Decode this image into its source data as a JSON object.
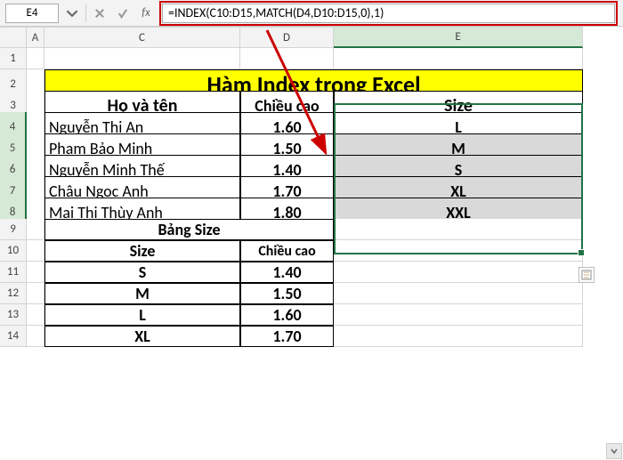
{
  "namebox": "E4",
  "formula": "=INDEX(C10:D15,MATCH(D4,D10:D15,0),1)",
  "columns": [
    "A",
    "C",
    "D",
    "E"
  ],
  "rows": [
    "1",
    "2",
    "3",
    "4",
    "5",
    "6",
    "7",
    "8",
    "9",
    "10",
    "11",
    "12",
    "13",
    "14"
  ],
  "title": "Hàm Index trong Excel",
  "headers": {
    "name": "Họ và tên",
    "height": "Chiều cao",
    "size": "Size",
    "sizetable": "Bảng Size",
    "sizecol": "Size",
    "heightcol": "Chiều cao"
  },
  "people": [
    {
      "name": "Nguyễn Thị An",
      "height": "1.60",
      "size": "L"
    },
    {
      "name": "Phạm Bảo Minh",
      "height": "1.50",
      "size": "M"
    },
    {
      "name": "Nguyễn Minh Thế",
      "height": "1.40",
      "size": "S"
    },
    {
      "name": "Châu Ngọc Anh",
      "height": "1.70",
      "size": "XL"
    },
    {
      "name": "Mai Thị Thùy Anh",
      "height": "1.80",
      "size": "XXL"
    }
  ],
  "sizetable": [
    {
      "size": "S",
      "height": "1.40"
    },
    {
      "size": "M",
      "height": "1.50"
    },
    {
      "size": "L",
      "height": "1.60"
    },
    {
      "size": "XL",
      "height": "1.70"
    }
  ]
}
